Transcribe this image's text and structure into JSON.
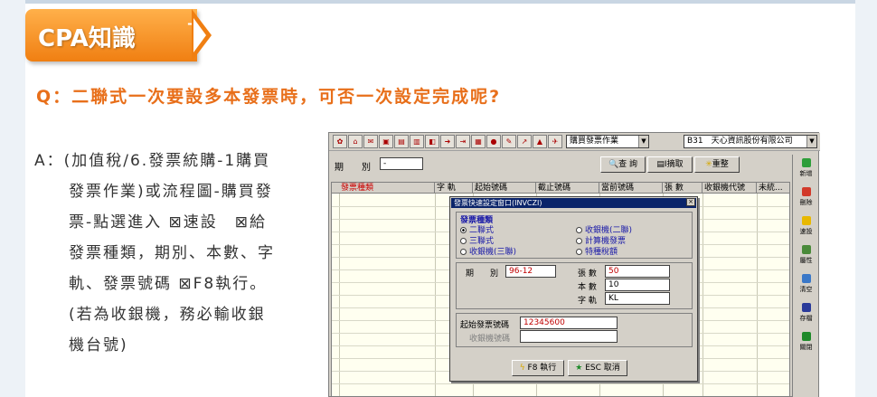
{
  "badge": {
    "label": "CPA知識",
    "plus": "+"
  },
  "question": "Q：二聯式一次要設多本發票時，可否一次設定完成呢?",
  "answer": {
    "line1": "A：(加值稅/6.發票統購-1購買",
    "lines": [
      "發票作業)或流程圖-購買發",
      "票-點選進入 ⊠速設　⊠給",
      "發票種類，期別、本數、字",
      "軌、發票號碼 ⊠F8執行。",
      "(若為收銀機，務必輸收銀",
      "機台號)"
    ]
  },
  "app": {
    "toolbar": {
      "module_combo": "購買發票作業",
      "company_combo": "B31　天心資訊股份有限公司"
    },
    "period_label": "期　　別",
    "period_value": "-",
    "query_label": "查 詢",
    "print_label": "I摘取",
    "reset_label": "重整",
    "grid_headers": [
      "發票種類",
      "字 軌",
      "起始號碼",
      "截止號碼",
      "當前號碼",
      "張 數",
      "收銀機代號",
      "未統..."
    ],
    "sidebar": [
      "新增",
      "刪除",
      "速設",
      "屬性",
      "清空",
      "存檔",
      "關閉"
    ],
    "dialog": {
      "title": "發票快速設定窗口(INVCZI)",
      "group_label": "發票種類",
      "options_left": [
        "二聯式",
        "三聯式",
        "收銀機(三聯)"
      ],
      "options_right": [
        "收銀機(二聯)",
        "計算機發票",
        "特種稅額"
      ],
      "period_label": "期　　別",
      "period_value": "96-12",
      "sheets_label": "張 數",
      "sheets_value": "50",
      "books_label": "本 數",
      "books_value": "10",
      "track_label": "字 軌",
      "track_value": "KL",
      "start_label": "起始發票號碼",
      "start_value": "12345600",
      "register_label": "收銀機號碼",
      "register_value": "",
      "execute_label": "F8 執行",
      "cancel_label": "ESC 取消"
    }
  },
  "colors": {
    "accent": "#e86f1a",
    "badge": "#f07f12",
    "dialog_title": "#0a246a"
  }
}
